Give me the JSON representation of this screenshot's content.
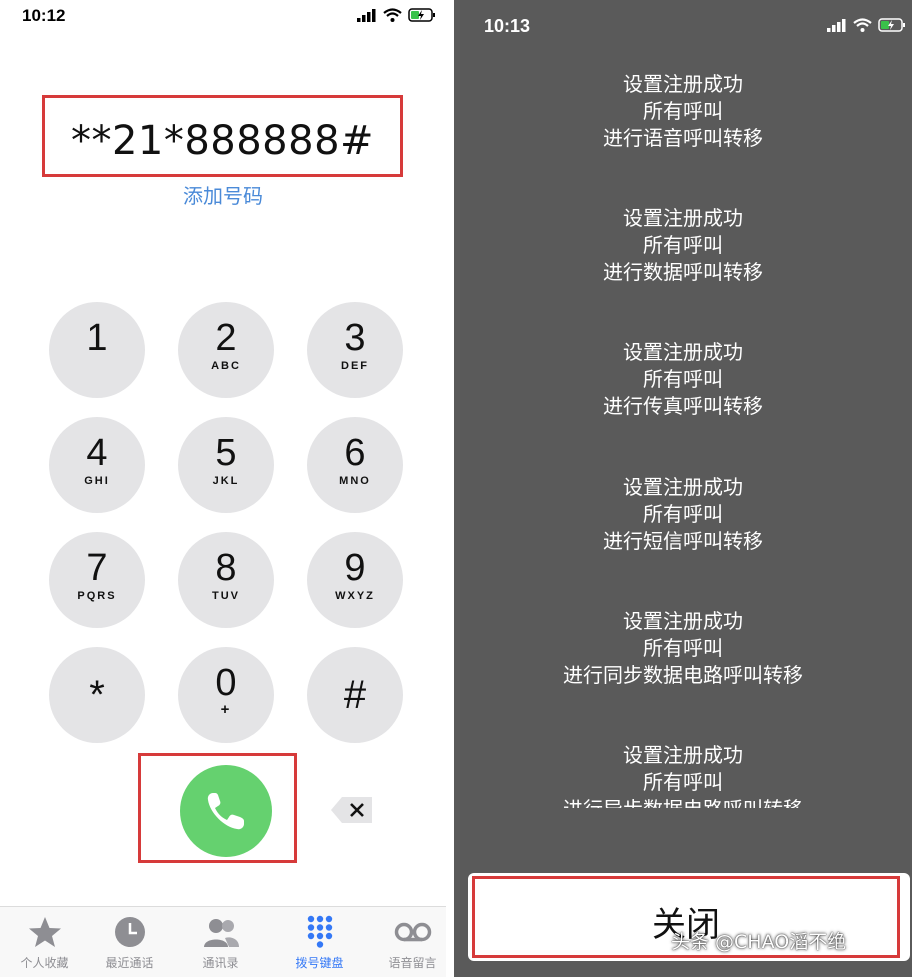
{
  "left": {
    "status_time": "10:12",
    "dialed_number": "**21*888888#",
    "add_number": "添加号码",
    "keys": [
      {
        "digit": "1",
        "letters": ""
      },
      {
        "digit": "2",
        "letters": "ABC"
      },
      {
        "digit": "3",
        "letters": "DEF"
      },
      {
        "digit": "4",
        "letters": "GHI"
      },
      {
        "digit": "5",
        "letters": "JKL"
      },
      {
        "digit": "6",
        "letters": "MNO"
      },
      {
        "digit": "7",
        "letters": "PQRS"
      },
      {
        "digit": "8",
        "letters": "TUV"
      },
      {
        "digit": "9",
        "letters": "WXYZ"
      },
      {
        "digit": "*",
        "letters": ""
      },
      {
        "digit": "0",
        "letters": "+"
      },
      {
        "digit": "#",
        "letters": ""
      }
    ],
    "tabs": [
      {
        "label": "个人收藏",
        "icon": "star-icon"
      },
      {
        "label": "最近通话",
        "icon": "clock-icon"
      },
      {
        "label": "通讯录",
        "icon": "contacts-icon"
      },
      {
        "label": "拨号键盘",
        "icon": "keypad-icon",
        "active": true
      },
      {
        "label": "语音留言",
        "icon": "voicemail-icon"
      }
    ]
  },
  "right": {
    "status_time": "10:13",
    "messages": [
      {
        "line1": "设置注册成功",
        "line2": "所有呼叫",
        "line3": "进行语音呼叫转移"
      },
      {
        "line1": "设置注册成功",
        "line2": "所有呼叫",
        "line3": "进行数据呼叫转移"
      },
      {
        "line1": "设置注册成功",
        "line2": "所有呼叫",
        "line3": "进行传真呼叫转移"
      },
      {
        "line1": "设置注册成功",
        "line2": "所有呼叫",
        "line3": "进行短信呼叫转移"
      },
      {
        "line1": "设置注册成功",
        "line2": "所有呼叫",
        "line3": "进行同步数据电路呼叫转移"
      },
      {
        "line1": "设置注册成功",
        "line2": "所有呼叫",
        "line3": "进行异步数据电路呼叫转移"
      }
    ],
    "close_label": "关闭",
    "watermark": "头条 @CHAO滔不绝"
  },
  "colors": {
    "highlight_border": "#d63a3a",
    "call_green": "#65d16f",
    "link_blue": "#4a8ad8",
    "active_tab": "#3478f6",
    "key_gray": "#e4e4e6",
    "dialog_bg": "#5a5a5a"
  }
}
